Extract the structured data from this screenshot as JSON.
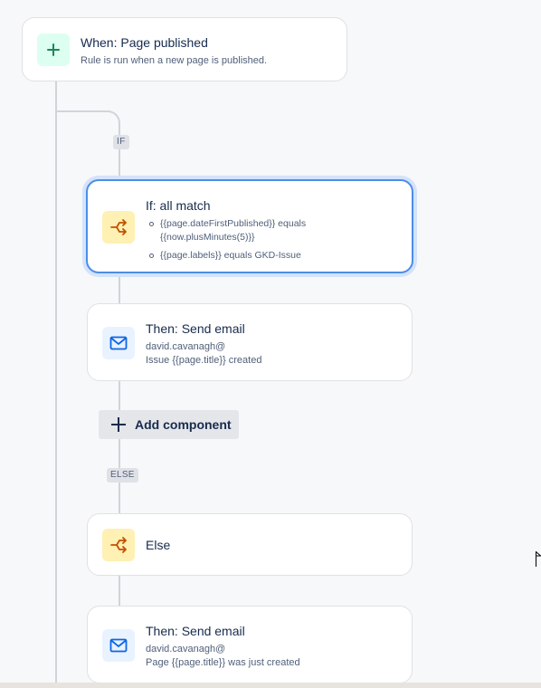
{
  "trigger": {
    "title": "When: Page published",
    "subtitle": "Rule is run when a new page is published.",
    "icon": "plus-icon",
    "icon_color": "#1f845a"
  },
  "branches": {
    "if_label": "IF",
    "else_label": "ELSE"
  },
  "condition": {
    "title": "If: all match",
    "icon": "branch-icon",
    "items": [
      {
        "line1": "{{page.dateFirstPublished}} equals",
        "line2": "{{now.plusMinutes(5)}}"
      },
      {
        "line1": "{{page.labels}} equals GKD-Issue"
      }
    ]
  },
  "action1": {
    "title": "Then: Send email",
    "to": "david.cavanagh@",
    "subject": "Issue {{page.title}} created",
    "icon": "mail-icon"
  },
  "add_component": {
    "label": "Add component",
    "icon": "plus-icon"
  },
  "else_block": {
    "title": "Else",
    "icon": "branch-icon"
  },
  "action2": {
    "title": "Then: Send email",
    "to": "david.cavanagh@",
    "subject": "Page {{page.title}} was just created",
    "icon": "mail-icon"
  },
  "colors": {
    "accent_blue": "#4c8ee8",
    "branch_orange": "#c25100",
    "mail_blue": "#0c66e4",
    "trigger_green": "#1f845a"
  }
}
